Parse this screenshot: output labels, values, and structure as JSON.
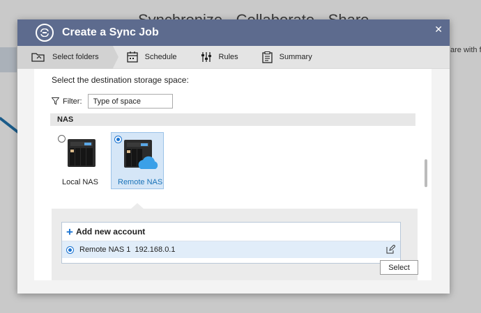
{
  "background": {
    "title": "Synchronize · Collaborate · Share",
    "side_text": "are with fri"
  },
  "dialog": {
    "title": "Create a Sync Job",
    "title_icon": "sync-icon",
    "close_label": "✕"
  },
  "steps": [
    {
      "label": "Select folders",
      "icon": "folder-sync-icon",
      "active": true
    },
    {
      "label": "Schedule",
      "icon": "calendar-icon",
      "active": false
    },
    {
      "label": "Rules",
      "icon": "sliders-icon",
      "active": false
    },
    {
      "label": "Summary",
      "icon": "clipboard-icon",
      "active": false
    }
  ],
  "content": {
    "heading": "Select the destination storage space:",
    "filter": {
      "label": "Filter:",
      "value": "Type of space",
      "icon": "filter-icon"
    },
    "section_label": "NAS",
    "storage_options": [
      {
        "label": "Local NAS",
        "selected": false,
        "icon": "nas-icon"
      },
      {
        "label": "Remote NAS",
        "selected": true,
        "icon": "nas-cloud-icon"
      }
    ],
    "accounts": {
      "add_label": "Add new account",
      "items": [
        {
          "name": "Remote NAS 1",
          "ip": "192.168.0.1",
          "selected": true
        }
      ]
    }
  },
  "footer": {
    "select_label": "Select"
  },
  "colors": {
    "titlebar": "#5d6b8e",
    "accent": "#1a73d1",
    "selected_card": "#d5e6f7"
  }
}
